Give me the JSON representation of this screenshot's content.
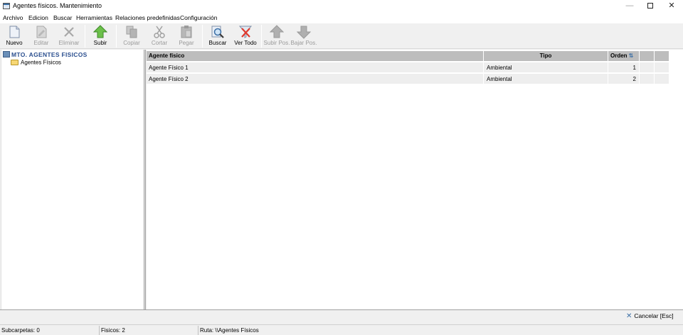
{
  "window": {
    "title": "Agentes físicos. Mantenimiento"
  },
  "menu": [
    "Archivo",
    "Edicion",
    "Buscar",
    "Herramientas",
    "Relaciones predefinidas",
    "Configuración"
  ],
  "toolbar": {
    "nuevo": "Nuevo",
    "editar": "Editar",
    "eliminar": "Eliminar",
    "subir": "Subir",
    "copiar": "Copiar",
    "cortar": "Cortar",
    "pegar": "Pegar",
    "buscar": "Buscar",
    "ver_todo": "Ver Todo",
    "subir_pos": "Subir Pos.",
    "bajar_pos": "Bajar Pos."
  },
  "tree": {
    "root": "MTO. AGENTES FISICOS",
    "child": "Agentes Físicos"
  },
  "grid": {
    "columns": [
      "Agente físico",
      "Tipo",
      "Orden"
    ],
    "rows": [
      {
        "agente": "Agente Físico 1",
        "tipo": "Ambiental",
        "orden": "1"
      },
      {
        "agente": "Agente Físico 2",
        "tipo": "Ambiental",
        "orden": "2"
      }
    ]
  },
  "bottom": {
    "cancel": "Cancelar [Esc]"
  },
  "status": {
    "subcarpetas": "Subcarpetas: 0",
    "fisicos": "Fisicos: 2",
    "ruta": "Ruta: \\\\Agentes Físicos"
  },
  "colors": {
    "accent": "#3a6ea5",
    "arrow_green": "#6cc04a",
    "header_gray": "#bdbdbd"
  }
}
